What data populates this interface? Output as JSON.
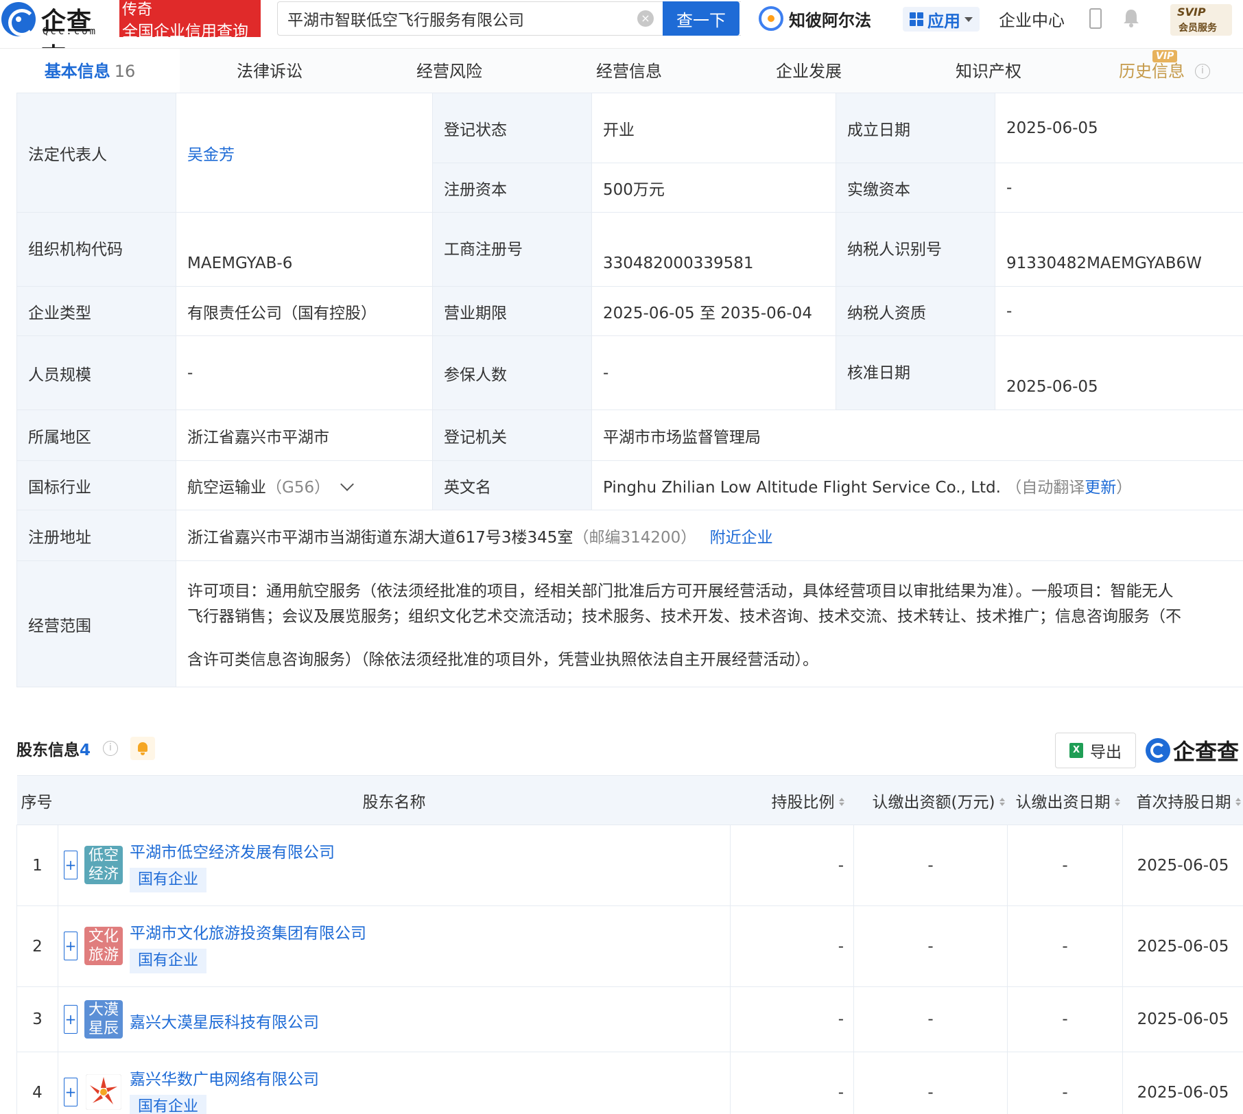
{
  "header": {
    "logo_cn": "企查查",
    "logo_en": "Qcc.com",
    "legend_top": "传奇",
    "legend_bottom": "全国企业信用查询",
    "search_value": "平湖市智联低空飞行服务有限公司",
    "search_button": "查一下",
    "zhibi": "知彼阿尔法",
    "apps": "应用",
    "center": "企业中心",
    "svip_top": "SVIP",
    "svip_bottom": "会员服务"
  },
  "tabs": [
    {
      "label": "基本信息",
      "count": "16"
    },
    {
      "label": "法律诉讼"
    },
    {
      "label": "经营风险"
    },
    {
      "label": "经营信息"
    },
    {
      "label": "企业发展"
    },
    {
      "label": "知识产权"
    },
    {
      "label": "历史信息",
      "tag": "VIP"
    }
  ],
  "basic": {
    "legal_rep_k": "法定代表人",
    "legal_rep_v": "吴金芳",
    "reg_status_k": "登记状态",
    "reg_status_v": "开业",
    "est_date_k": "成立日期",
    "est_date_v": "2025-06-05",
    "reg_capital_k": "注册资本",
    "reg_capital_v": "500万元",
    "paid_capital_k": "实缴资本",
    "paid_capital_v": "-",
    "org_code_k": "组织机构代码",
    "org_code_v": "MAEMGYAB-6",
    "biz_reg_no_k": "工商注册号",
    "biz_reg_no_v": "330482000339581",
    "tax_id_k": "纳税人识别号",
    "tax_id_v": "91330482MAEMGYAB6W",
    "ent_type_k": "企业类型",
    "ent_type_v": "有限责任公司（国有控股）",
    "biz_term_k": "营业期限",
    "biz_term_v": "2025-06-05 至 2035-06-04",
    "tax_qual_k": "纳税人资质",
    "tax_qual_v": "-",
    "staff_k": "人员规模",
    "staff_v": "-",
    "insured_k": "参保人数",
    "insured_v": "-",
    "approve_k": "核准日期",
    "approve_v": "2025-06-05",
    "region_k": "所属地区",
    "region_v": "浙江省嘉兴市平湖市",
    "authority_k": "登记机关",
    "authority_v": "平湖市市场监督管理局",
    "industry_k": "国标行业",
    "industry_v": "航空运输业",
    "industry_code": "（G56）",
    "en_name_k": "英文名",
    "en_name_v": "Pinghu Zhilian Low Altitude Flight Service Co., Ltd.",
    "en_auto": "（自动翻译",
    "en_update": "更新",
    "en_close": "）",
    "address_k": "注册地址",
    "address_v": "浙江省嘉兴市平湖市当湖街道东湖大道617号3楼345室",
    "postcode": "（邮编314200）",
    "nearby": "附近企业",
    "scope_k": "经营范围",
    "scope_line1": "许可项目：通用航空服务（依法须经批准的项目，经相关部门批准后方可开展经营活动，具体经营项目以审批结果为准）。一般项目：智能无人",
    "scope_line2": "飞行器销售；会议及展览服务；组织文化艺术交流活动；技术服务、技术开发、技术咨询、技术交流、技术转让、技术推广；信息咨询服务（不",
    "scope_line3": "含许可类信息咨询服务）（除依法须经批准的项目外，凭营业执照依法自主开展经营活动）。"
  },
  "shareholders": {
    "title": "股东信息",
    "count": "4",
    "export": "导出",
    "brand": "企查查",
    "columns": [
      "序号",
      "股东名称",
      "持股比例",
      "认缴出资额(万元)",
      "认缴出资日期",
      "首次持股日期"
    ],
    "rows": [
      {
        "no": "1",
        "name": "平湖市低空经济发展有限公司",
        "logo": "低空经济",
        "logo_l1": "低空",
        "logo_l2": "经济",
        "logo_color": "#5aa7b8",
        "tag": "国有企业",
        "ratio": "-",
        "amount": "-",
        "date": "-",
        "first": "2025-06-05"
      },
      {
        "no": "2",
        "name": "平湖市文化旅游投资集团有限公司",
        "logo": "文化旅游",
        "logo_l1": "文化",
        "logo_l2": "旅游",
        "logo_color": "#e07d7d",
        "tag": "国有企业",
        "ratio": "-",
        "amount": "-",
        "date": "-",
        "first": "2025-06-05"
      },
      {
        "no": "3",
        "name": "嘉兴大漠星辰科技有限公司",
        "logo": "大漠星辰",
        "logo_l1": "大漠",
        "logo_l2": "星辰",
        "logo_color": "#5b8fd6",
        "tag": "",
        "ratio": "-",
        "amount": "-",
        "date": "-",
        "first": "2025-06-05"
      },
      {
        "no": "4",
        "name": "嘉兴华数广电网络有限公司",
        "logo": "",
        "logo_color": "#e0402a",
        "tag": "国有企业",
        "ratio": "-",
        "amount": "-",
        "date": "-",
        "first": "2025-06-05"
      }
    ]
  }
}
